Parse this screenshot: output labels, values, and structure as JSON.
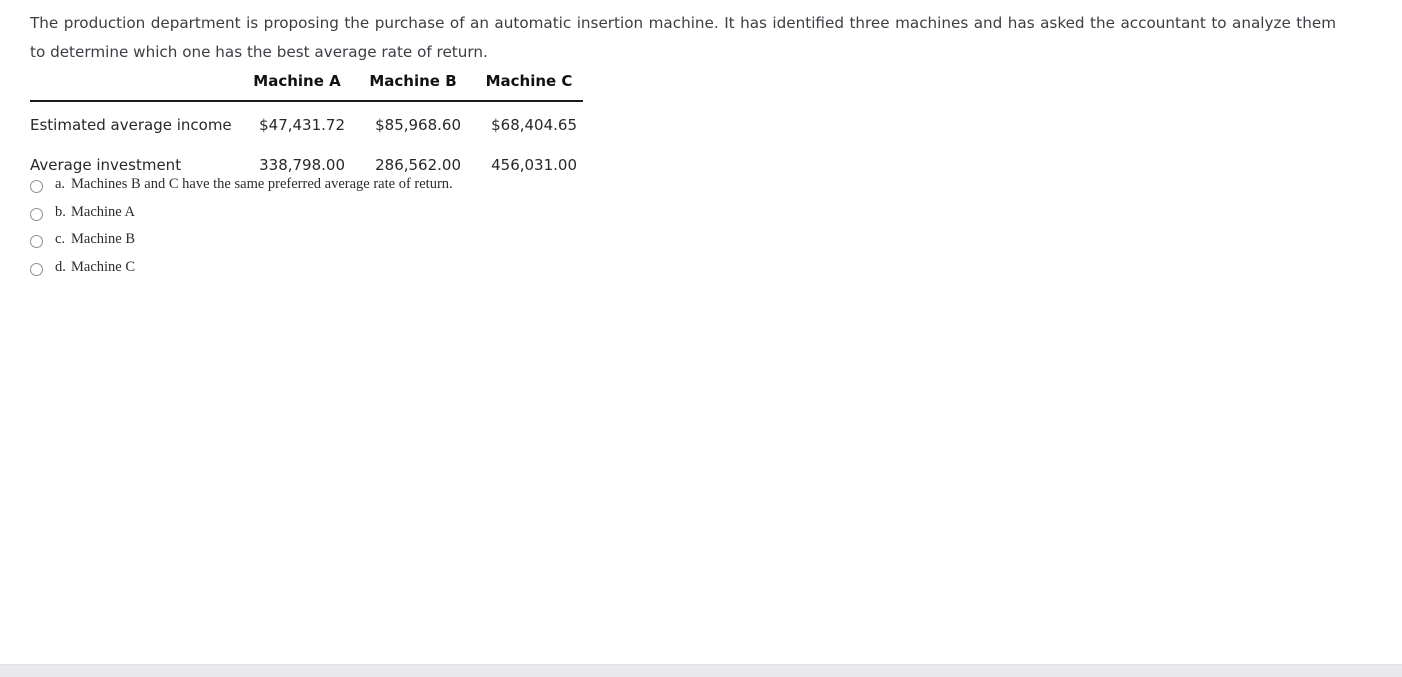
{
  "question": {
    "stem": "The production department is proposing the purchase of an automatic insertion machine. It has identified three machines and has asked the accountant to analyze them to determine which one has the best average rate of return."
  },
  "table": {
    "corner_label": "",
    "columns": [
      "Machine A",
      "Machine B",
      "Machine C"
    ],
    "rows": [
      {
        "label": "Estimated average income",
        "values": [
          "$47,431.72",
          "$85,968.60",
          "$68,404.65"
        ]
      },
      {
        "label": "Average investment",
        "values": [
          "338,798.00",
          "286,562.00",
          "456,031.00"
        ]
      }
    ]
  },
  "options": [
    {
      "letter": "a.",
      "text": "Machines B and C have the same preferred average rate of return.",
      "selected": false
    },
    {
      "letter": "b.",
      "text": "Machine A",
      "selected": false
    },
    {
      "letter": "c.",
      "text": "Machine B",
      "selected": false
    },
    {
      "letter": "d.",
      "text": "Machine C",
      "selected": false
    }
  ],
  "colors": {
    "body_text": "#3b3e43",
    "table_text": "#26282c",
    "rule": "#1a1a1a",
    "radio_border": "#8d8f94",
    "bottom_divider": "#e9e9eb",
    "background": "#ffffff"
  }
}
